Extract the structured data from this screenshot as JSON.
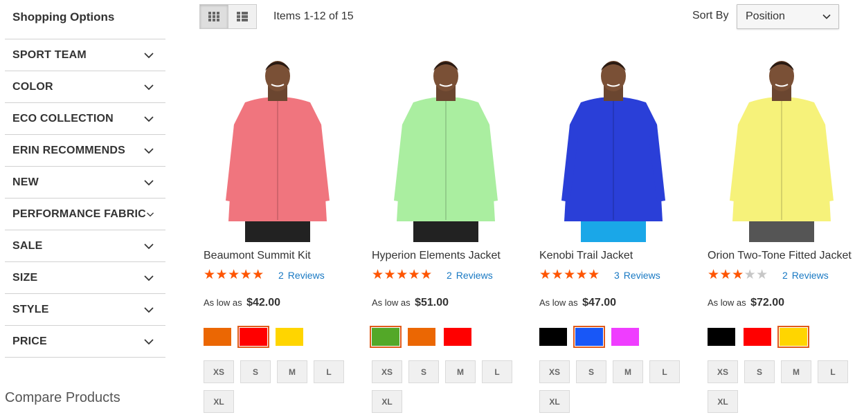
{
  "sidebar": {
    "title": "Shopping Options",
    "filters": [
      "SPORT TEAM",
      "COLOR",
      "ECO COLLECTION",
      "ERIN RECOMMENDS",
      "NEW",
      "PERFORMANCE FABRIC",
      "SALE",
      "SIZE",
      "STYLE",
      "PRICE"
    ],
    "compare_title": "Compare Products"
  },
  "toolbar": {
    "grid_icon": "grid-icon",
    "list_icon": "list-icon",
    "amount": "Items 1-12 of 15",
    "sort_label": "Sort By",
    "sort_value": "Position"
  },
  "products": [
    {
      "name": "Beaumont Summit Kit",
      "rating": 4.5,
      "review_count": "2",
      "review_label": "Reviews",
      "price_label": "As low as",
      "price": "$42.00",
      "jacket_color": "#f0757e",
      "pants_color": "#222222",
      "swatches": [
        {
          "color": "#eb6703",
          "selected": false
        },
        {
          "color": "#ff0000",
          "selected": true
        },
        {
          "color": "#ffd500",
          "selected": false
        }
      ],
      "sizes": [
        "XS",
        "S",
        "M",
        "L",
        "XL"
      ]
    },
    {
      "name": "Hyperion Elements Jacket",
      "rating": 4.5,
      "review_count": "2",
      "review_label": "Reviews",
      "price_label": "As low as",
      "price": "$51.00",
      "jacket_color": "#aaeea0",
      "pants_color": "#222222",
      "swatches": [
        {
          "color": "#53a828",
          "selected": true
        },
        {
          "color": "#eb6703",
          "selected": false
        },
        {
          "color": "#ff0000",
          "selected": false
        }
      ],
      "sizes": [
        "XS",
        "S",
        "M",
        "L",
        "XL"
      ]
    },
    {
      "name": "Kenobi Trail Jacket",
      "rating": 4.6,
      "review_count": "3",
      "review_label": "Reviews",
      "price_label": "As low as",
      "price": "$47.00",
      "jacket_color": "#2a3fd8",
      "pants_color": "#1aa7e8",
      "swatches": [
        {
          "color": "#000000",
          "selected": false
        },
        {
          "color": "#1857f7",
          "selected": true
        },
        {
          "color": "#ef3dff",
          "selected": false
        }
      ],
      "sizes": [
        "XS",
        "S",
        "M",
        "L",
        "XL"
      ]
    },
    {
      "name": "Orion Two-Tone Fitted Jacket",
      "rating": 2.5,
      "review_count": "2",
      "review_label": "Reviews",
      "price_label": "As low as",
      "price": "$72.00",
      "jacket_color": "#f6f27a",
      "pants_color": "#555555",
      "swatches": [
        {
          "color": "#000000",
          "selected": false
        },
        {
          "color": "#ff0000",
          "selected": false
        },
        {
          "color": "#ffd500",
          "selected": true
        }
      ],
      "sizes": [
        "XS",
        "S",
        "M",
        "L",
        "XL"
      ]
    }
  ]
}
